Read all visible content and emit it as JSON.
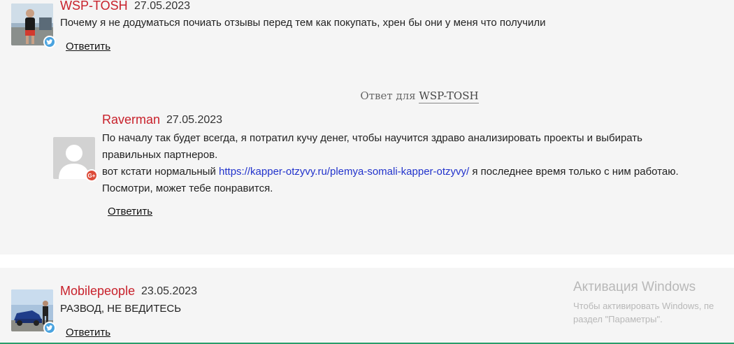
{
  "comments": [
    {
      "author": "WSP-TOSH",
      "date": "27.05.2023",
      "text": "Почему я не додуматься почиать отзывы перед тем как покупать, хрен бы они у меня что получили",
      "reply_label": "Ответить",
      "badge": "twitter-icon"
    },
    {
      "reply_to_prefix": "Ответ для",
      "reply_to_name": "WSP-TOSH",
      "author": "Raverman",
      "date": "27.05.2023",
      "text_line1": "По началу так будет всегда, я потратил кучу денег, чтобы научится здраво анализировать проекты и выбирать",
      "text_line2": "правильных партнеров.",
      "text_line3_before": "вот кстати нормальный",
      "link": "https://kapper-otzyvy.ru/plemya-somali-kapper-otzyvy/",
      "text_line3_after": "я последнее время только с ним работаю.",
      "text_line4": "Посмотри, может тебе понравится.",
      "reply_label": "Ответить",
      "badge": "google-plus-icon",
      "badge_text": "G+"
    },
    {
      "author": "Mobilepeople",
      "date": "23.05.2023",
      "text": "РАЗВОД, НЕ ВЕДИТЕСЬ",
      "reply_label": "Ответить",
      "badge": "twitter-icon"
    }
  ],
  "watermark": {
    "title": "Активация Windows",
    "line1": "Чтобы активировать Windows, пе",
    "line2": "раздел \"Параметры\"."
  },
  "colors": {
    "author": "#c8212b",
    "link": "#2233cc",
    "background": "#f5f5f5",
    "twitter": "#4aa3df",
    "google_plus": "#dd4b39"
  }
}
